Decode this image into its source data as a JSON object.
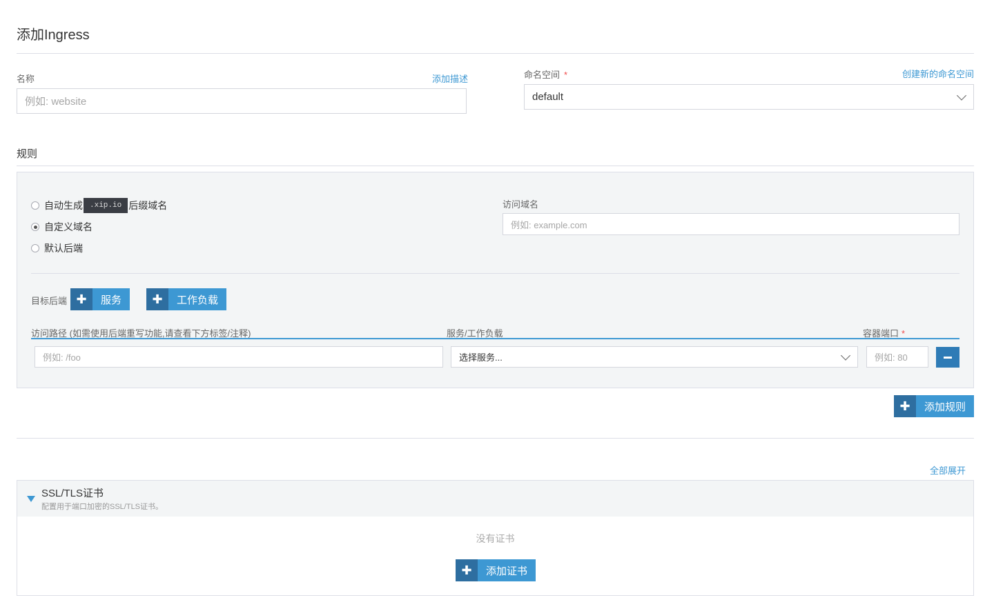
{
  "page": {
    "title": "添加Ingress"
  },
  "name_field": {
    "label": "名称",
    "placeholder": "例如: website",
    "add_description": "添加描述"
  },
  "namespace_field": {
    "label": "命名空间",
    "required_mark": "*",
    "create_link": "创建新的命名空间",
    "value": "default"
  },
  "rules": {
    "section_title": "规则",
    "radio_options": [
      {
        "label_before": "自动生成",
        "code": ".xip.io",
        "label_after": "后缀域名",
        "selected": false
      },
      {
        "label": "自定义域名",
        "selected": true
      },
      {
        "label": "默认后端",
        "selected": false
      }
    ],
    "domain": {
      "label": "访问域名",
      "placeholder": "例如: example.com"
    },
    "target_backend": {
      "label": "目标后端",
      "add_service": "服务",
      "add_workload": "工作负载"
    },
    "columns": {
      "path": "访问路径 (如需使用后端重写功能,请查看下方标签/注释)",
      "service": "服务/工作负载",
      "port": "容器端口",
      "port_required": "*"
    },
    "row": {
      "path_placeholder": "例如: /foo",
      "service_placeholder": "选择服务...",
      "port_placeholder": "例如: 80"
    },
    "add_rule": "添加规则"
  },
  "expand_all": "全部展开",
  "ssl": {
    "title": "SSL/TLS证书",
    "subtitle": "配置用于端口加密的SSL/TLS证书。",
    "empty": "没有证书",
    "add_button": "添加证书"
  },
  "colors": {
    "accent": "#3d98d3",
    "accent_dark": "#2e6ea0",
    "panel_bg": "#f3f5f6",
    "required": "#f04b4b"
  }
}
